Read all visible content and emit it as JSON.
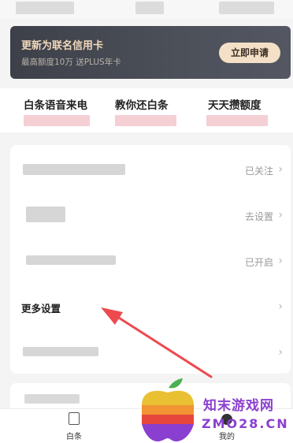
{
  "promo": {
    "title": "更新为联名信用卡",
    "subtitle": "最高额度10万 送PLUS年卡",
    "button_label": "立即申请"
  },
  "shortcuts": [
    {
      "label": "白条语音来电"
    },
    {
      "label": "教你还白条"
    },
    {
      "label": "天天攒额度"
    }
  ],
  "settings": {
    "rows": [
      {
        "status": "已关注"
      },
      {
        "status": "去设置"
      },
      {
        "status": "已开启"
      },
      {
        "title": "更多设置"
      }
    ]
  },
  "tabbar": {
    "left_label": "白条",
    "right_label": "我的"
  },
  "watermark": {
    "name": "知末游戏网",
    "url": "ZMO28.CN"
  },
  "colors": {
    "promo_title": "#f1d9bb",
    "promo_button": "#f4e0c7",
    "arrow": "#ec4a4f",
    "watermark": "#8b3fd0"
  }
}
